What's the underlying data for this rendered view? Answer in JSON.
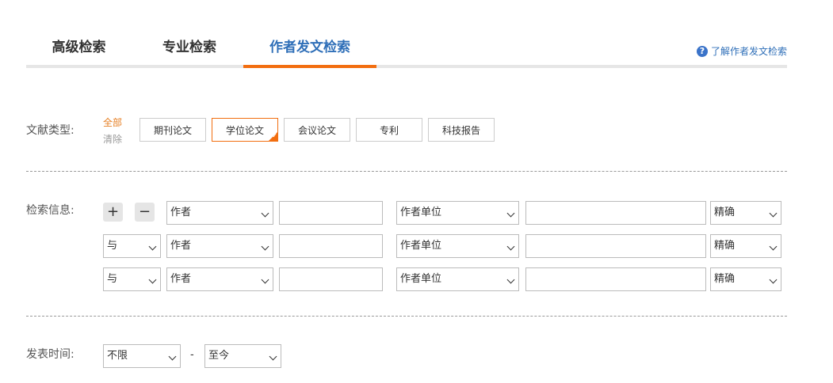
{
  "tabs": [
    {
      "label": "高级检索"
    },
    {
      "label": "专业检索"
    },
    {
      "label": "作者发文检索"
    }
  ],
  "help": {
    "label": "了解作者发文检索",
    "icon": "question-circle-icon"
  },
  "doc_type": {
    "label": "文献类型:",
    "all_label": "全部",
    "clear_label": "清除",
    "options": [
      {
        "label": "期刊论文"
      },
      {
        "label": "学位论文"
      },
      {
        "label": "会议论文"
      },
      {
        "label": "专利"
      },
      {
        "label": "科技报告"
      }
    ],
    "selected": "学位论文"
  },
  "search_info": {
    "label": "检索信息:",
    "add_label": "+",
    "remove_label": "−",
    "rows": [
      {
        "logic": "",
        "field": "作者",
        "value": "",
        "field2": "作者单位",
        "value2": "",
        "match": "精确"
      },
      {
        "logic": "与",
        "field": "作者",
        "value": "",
        "field2": "作者单位",
        "value2": "",
        "match": "精确"
      },
      {
        "logic": "与",
        "field": "作者",
        "value": "",
        "field2": "作者单位",
        "value2": "",
        "match": "精确"
      }
    ]
  },
  "pub_time": {
    "label": "发表时间:",
    "from": "不限",
    "separator": "-",
    "to": "至今"
  },
  "colors": {
    "accent": "#f26e10",
    "link": "#2f6fb8"
  }
}
